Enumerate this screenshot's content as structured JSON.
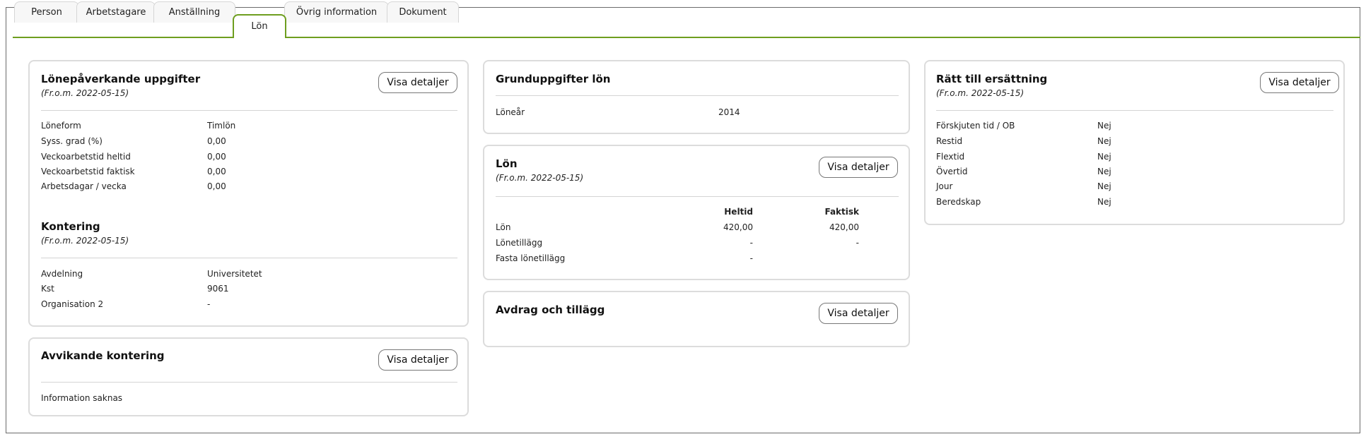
{
  "tabs": [
    "Person",
    "Arbetstagare",
    "Anställning",
    "Lön",
    "Övrig information",
    "Dokument"
  ],
  "active_tab": "Lön",
  "button_label": "Visa detaljer",
  "lonepaverkande": {
    "title": "Lönepåverkande uppgifter",
    "from": "(Fr.o.m. 2022-05-15)",
    "rows": [
      {
        "label": "Löneform",
        "value": "Timlön"
      },
      {
        "label": "Syss. grad (%)",
        "value": "0,00"
      },
      {
        "label": "Veckoarbetstid heltid",
        "value": "0,00"
      },
      {
        "label": "Veckoarbetstid faktisk",
        "value": "0,00"
      },
      {
        "label": "Arbetsdagar / vecka",
        "value": "0,00"
      }
    ]
  },
  "kontering": {
    "title": "Kontering",
    "from": "(Fr.o.m. 2022-05-15)",
    "rows": [
      {
        "label": "Avdelning",
        "value": "Universitetet"
      },
      {
        "label": "Kst",
        "value": "9061"
      },
      {
        "label": "Organisation 2",
        "value": "-"
      }
    ]
  },
  "avvikande": {
    "title": "Avvikande kontering",
    "info": "Information saknas"
  },
  "grunduppgifter": {
    "title": "Grunduppgifter lön",
    "rows": [
      {
        "label": "Löneår",
        "value": "2014"
      }
    ]
  },
  "lon": {
    "title": "Lön",
    "from": "(Fr.o.m. 2022-05-15)",
    "col_heltid": "Heltid",
    "col_faktisk": "Faktisk",
    "rows": [
      {
        "label": "Lön",
        "heltid": "420,00",
        "faktisk": "420,00"
      },
      {
        "label": "Lönetillägg",
        "heltid": "-",
        "faktisk": "-"
      },
      {
        "label": "Fasta lönetillägg",
        "heltid": "-",
        "faktisk": ""
      }
    ]
  },
  "avdrag": {
    "title": "Avdrag och tillägg"
  },
  "ratt": {
    "title": "Rätt till ersättning",
    "from": "(Fr.o.m. 2022-05-15)",
    "rows": [
      {
        "label": "Förskjuten tid / OB",
        "value": "Nej"
      },
      {
        "label": "Restid",
        "value": "Nej"
      },
      {
        "label": "Flextid",
        "value": "Nej"
      },
      {
        "label": "Övertid",
        "value": "Nej"
      },
      {
        "label": "Jour",
        "value": "Nej"
      },
      {
        "label": "Beredskap",
        "value": "Nej"
      }
    ]
  },
  "colors": {
    "accent": "#6e9e1f",
    "border": "#dcdcdc"
  }
}
